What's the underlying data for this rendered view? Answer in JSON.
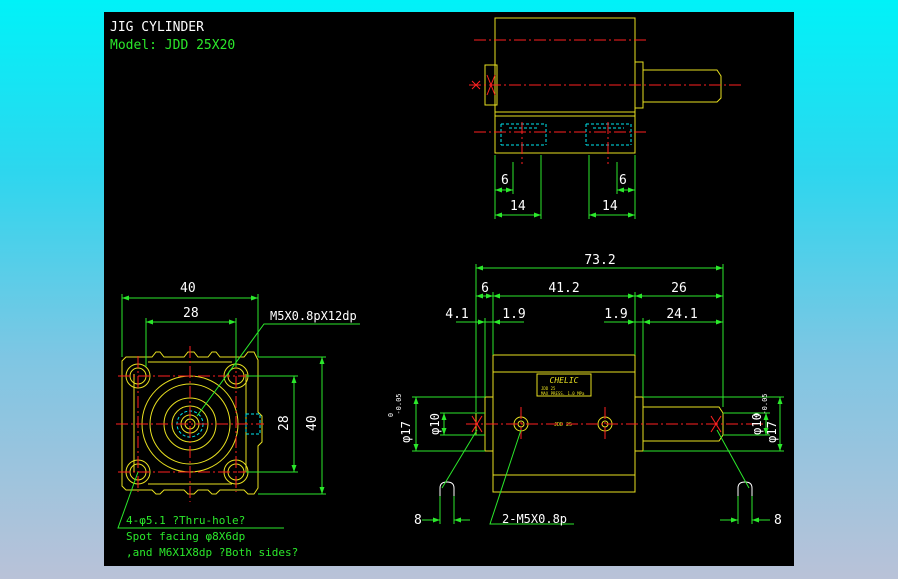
{
  "title": "JIG CYLINDER",
  "model": "Model: JDD 25X20",
  "front_view": {
    "width_overall": "40",
    "hole_pitch_horizontal": "28",
    "thread_callout": "M5X0.8pX12dp",
    "hole_pitch_vertical": "28",
    "height_overall": "40",
    "hole_note_1": "4-φ5.1 ?Thru-hole?",
    "hole_note_2": "Spot facing φ8X6dp",
    "hole_note_3": ",and M6X1X8dp ?Both sides?"
  },
  "top_view": {
    "dim_left_small": "6",
    "dim_right_small": "6",
    "dim_left": "14",
    "dim_right": "14"
  },
  "side_view": {
    "total_length": "73.2",
    "dim_6": "6",
    "dim_body": "41.2",
    "dim_26": "26",
    "dim_4_1": "4.1",
    "dim_1_9_left": "1.9",
    "dim_1_9_right": "1.9",
    "dim_24_1": "24.1",
    "rod_dia_left": "φ10",
    "rod_dia_right": "φ10",
    "boss_dia_left": "φ17",
    "boss_dia_right": "φ17",
    "tol_upper": "0",
    "tol_lower": "-0.05",
    "port_callout": "2-M5X0.8p",
    "width_left": "8",
    "width_right": "8",
    "label_brand": "CHELIC",
    "label_line_1": "JDD 25",
    "label_line_2": "MAX PRESS. 1.0 MPa",
    "body_mark": "JDD 25"
  }
}
